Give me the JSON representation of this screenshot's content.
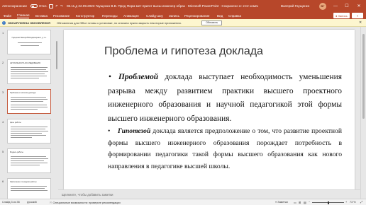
{
  "titlebar": {
    "autosave_label": "Автосохранение",
    "autosave_toggle": "Откл.",
    "doc_title": "06.11.д 22.09.2023 Гаущенко В.В. Пред Форм мет-пригот высш инженер образ  ·  Microsoft PowerPoint  ·  Сохранено в: этот компьютер",
    "user_name": "Валерий Гаущенко",
    "user_initials": "ВГ",
    "minimize": "—",
    "maximize": "☐",
    "close": "✕"
  },
  "menu": {
    "items": [
      "Файл",
      "Главная",
      "Вставка",
      "Рисование",
      "Конструктор",
      "Переходы",
      "Анимация",
      "Слайд-шоу",
      "Запись",
      "Рецензирование",
      "Вид",
      "Справка"
    ],
    "record_label": "● Запись",
    "share_label": "⇪"
  },
  "notification": {
    "title": "ОБНАРУЖЕНЫ ОБНОВЛЕНИЯ",
    "message": "Обновления для Office готовы к установке, но сначала нужно закрыть некоторые приложения.",
    "button": "Обновить",
    "close": "✕"
  },
  "thumbnails": [
    {
      "num": "1",
      "title": "Гаущенко Валерий Владимирович, д.т.н."
    },
    {
      "num": "2",
      "title": "АКТУАЛЬНОСТЬ ИССЛЕДОВАНИЯ"
    },
    {
      "num": "3",
      "title": "Проблема и гипотеза доклада"
    },
    {
      "num": "4",
      "title": "Цель работы"
    },
    {
      "num": "5",
      "title": "Модель работы"
    },
    {
      "num": "6",
      "title": "Заключение по модели работы"
    }
  ],
  "slide": {
    "title": "Проблема и гипотеза доклада",
    "bullet": "•",
    "p1_term": "Проблемой",
    "p1_text": " доклада выступает необходимость уменьшения разрыва между развитием практики высшего проектного инженерного образования и научной педагогикой этой формы высшего инженерного образования.",
    "p2_term": "Гипотезой",
    "p2_text": " доклада является предположение о том, что развитие проектной формы высшего инженерного образования порождает потребность в формировании педагогики такой формы высшего образования как нового направления в педагогике высшей школы."
  },
  "notes": {
    "placeholder": "Щелкните, чтобы добавить заметки"
  },
  "status": {
    "slide_counter": "Слайд 3 из 35",
    "language": "русский",
    "accessibility": "Специальные возможности: проверьте рекомендации",
    "notes_button": "Заметки",
    "zoom_minus": "−",
    "zoom_plus": "+",
    "zoom_level": "73 %"
  }
}
